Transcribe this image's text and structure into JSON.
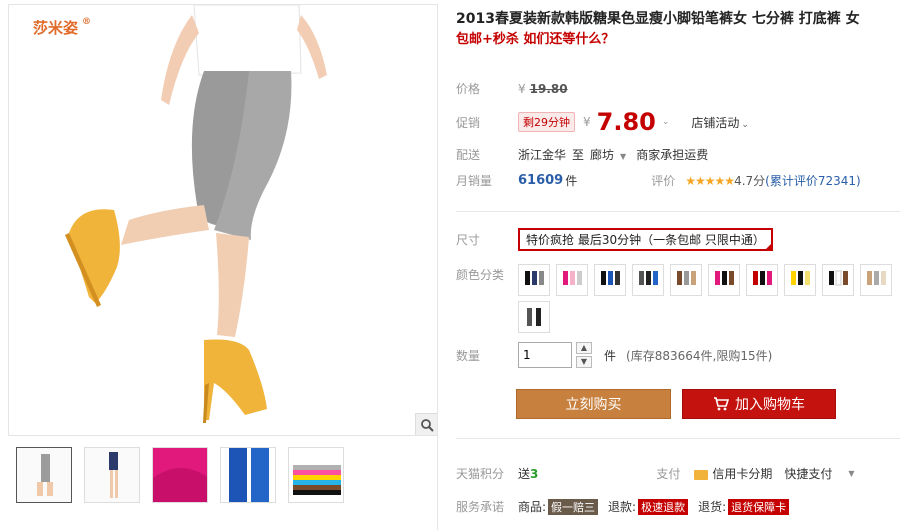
{
  "brand": {
    "name": "莎米姿",
    "mark": "®"
  },
  "product": {
    "title": "2013春夏装新款韩版糖果色显瘦小脚铅笔裤女 七分裤 打底裤 女",
    "subtitle": "包邮+秒杀 如们还等什么？"
  },
  "price": {
    "label": "价格",
    "currency": "¥",
    "original": "19.80",
    "promo_label": "促销",
    "promo_tag": "剩29分钟",
    "promo_value": "7.80",
    "activity": "店铺活动"
  },
  "shipping": {
    "label": "配送",
    "from": "浙江金华",
    "to_word": "至",
    "dest": "廊坊",
    "fee": "商家承担运费"
  },
  "sales": {
    "label": "月销量",
    "count": "61609",
    "unit": "件",
    "rating_label": "评价",
    "stars": "★★★★★",
    "score": "4.7分",
    "reviews": "(累计评价72341)"
  },
  "size": {
    "label": "尺寸",
    "option": "特价疯抢 最后30分钟（一条包邮 只限中通）"
  },
  "color": {
    "label": "颜色分类"
  },
  "quantity": {
    "label": "数量",
    "value": "1",
    "unit": "件",
    "stock": "(库存883664件,限购15件)"
  },
  "buttons": {
    "buy": "立刻购买",
    "cart": "加入购物车"
  },
  "points": {
    "label": "天猫积分",
    "text": "送",
    "value": "3",
    "pay_label": "支付",
    "credit": "信用卡分期",
    "quick": "快捷支付"
  },
  "service": {
    "label": "服务承诺",
    "goods": "商品:",
    "goods_tag": "假一赔三",
    "refund": "退款:",
    "refund_tag": "极速退款",
    "return": "退货:",
    "return_tag": "退货保障卡"
  },
  "colors": {
    "accent": "#c40000",
    "buy": "#c8803f",
    "cart": "#c4120e",
    "link": "#2a5ea8"
  },
  "icons": {
    "zoom": "magnifier-icon",
    "cart": "cart-icon",
    "stars": "star-rating-icon"
  }
}
